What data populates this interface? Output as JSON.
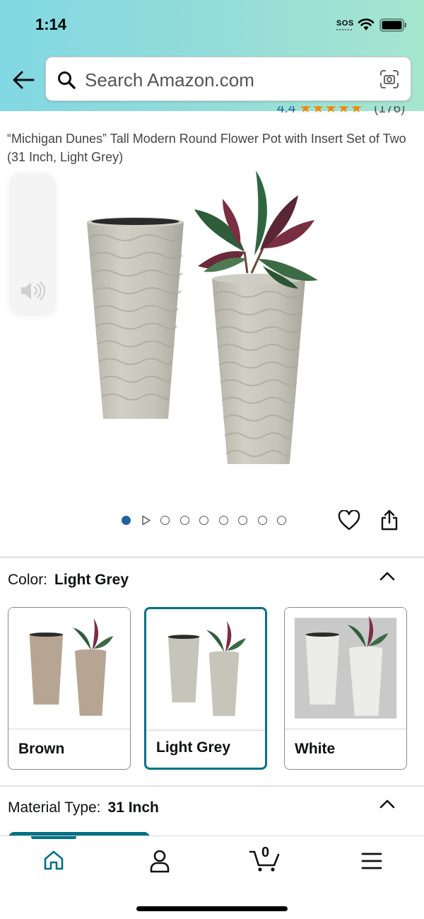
{
  "status_bar": {
    "time": "1:14",
    "sos": "SOS"
  },
  "search": {
    "placeholder": "Search Amazon.com"
  },
  "rating": {
    "value": "4.4",
    "stars": "★★★★★",
    "count": "(176)"
  },
  "product": {
    "title": "“Michigan Dunes” Tall Modern Round Flower Pot with Insert Set of Two (31 Inch, Light Grey)"
  },
  "gallery": {
    "total_images": 9,
    "active_index": 0
  },
  "color": {
    "label": "Color:",
    "selected": "Light Grey",
    "options": [
      {
        "name": "Brown",
        "pot_color": "#b5a592"
      },
      {
        "name": "Light Grey",
        "pot_color": "#c7c4ba"
      },
      {
        "name": "White",
        "pot_color": "#ecece8"
      }
    ]
  },
  "material": {
    "label": "Material Type:",
    "selected": "31 Inch"
  },
  "bottom_nav": {
    "items": [
      "home-icon",
      "account-icon",
      "cart-icon",
      "menu-icon"
    ],
    "cart_count": "0"
  },
  "colors": {
    "accent": "#007185",
    "link": "#2162a1",
    "star": "#f08804"
  }
}
